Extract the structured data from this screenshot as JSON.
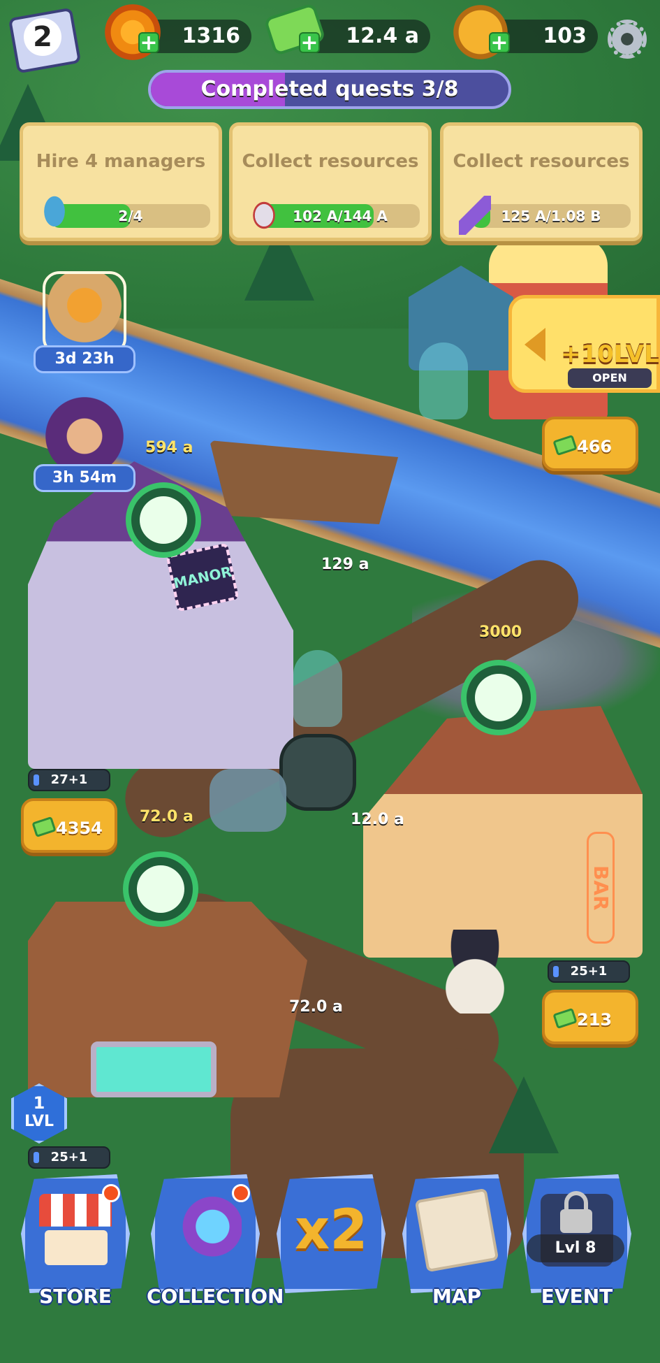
{
  "hud": {
    "player_level": "2",
    "resources": [
      {
        "name": "marigold",
        "icon": "marigold-icon",
        "value": "1316"
      },
      {
        "name": "cash",
        "icon": "cash-icon",
        "value": "12.4 a"
      },
      {
        "name": "skull-coin",
        "icon": "skull-coin-icon",
        "value": "103"
      }
    ],
    "settings_icon": "gear-icon"
  },
  "quests": {
    "progress_label": "Completed quests 3/8",
    "progress_fraction": 0.375,
    "cards": [
      {
        "title": "Hire 4 managers",
        "progress_text": "2/4",
        "progress_fraction": 0.5,
        "icon": "imp-icon"
      },
      {
        "title": "Collect resources",
        "progress_text": "102 A/144 A",
        "progress_fraction": 0.71,
        "icon": "fang-icon"
      },
      {
        "title": "Collect resources",
        "progress_text": "125 A/1.08 B",
        "progress_fraction": 0.12,
        "icon": "sword-icon"
      }
    ]
  },
  "side_offers": [
    {
      "name": "basket-offer",
      "timer": "3d 23h"
    },
    {
      "name": "mask-offer",
      "timer": "3h 54m"
    }
  ],
  "event_banner": {
    "text": "+10LVL",
    "status": "OPEN"
  },
  "map_labels": {
    "manor_production": "594 a",
    "boat_production": "129 a",
    "bar_production": "3000",
    "forge_production": "72.0 a",
    "table_production_1": "12.0 a",
    "table_production_2": "72.0 a",
    "lighthouse_cash": "466",
    "manor_cash": "4354",
    "bar_cash": "213",
    "manor_managers": "27+1",
    "bar_managers": "25+1",
    "dock_managers": "25+1",
    "manor_sign": "MANOR",
    "bar_sign": "BAR",
    "dock_level_number": "1",
    "dock_level_label": "LVL"
  },
  "nav": [
    {
      "label": "STORE",
      "icon": "store-icon",
      "notification": true
    },
    {
      "label": "COLLECTION",
      "icon": "collection-icon",
      "notification": true
    },
    {
      "label": "",
      "icon": "x2-boost-icon",
      "boost_text": "x2",
      "notification": false
    },
    {
      "label": "MAP",
      "icon": "map-icon",
      "notification": false
    },
    {
      "label": "EVENT",
      "icon": "lock-icon",
      "locked_text": "Lvl 8",
      "notification": false
    }
  ],
  "colors": {
    "grass": "#2f7a3e",
    "river": "#3a74d4",
    "progress_green": "#41c13f",
    "quest_bar_purple": "#a84ad8",
    "nav_blue": "#3a6fd6",
    "gold": "#f3b42d"
  }
}
